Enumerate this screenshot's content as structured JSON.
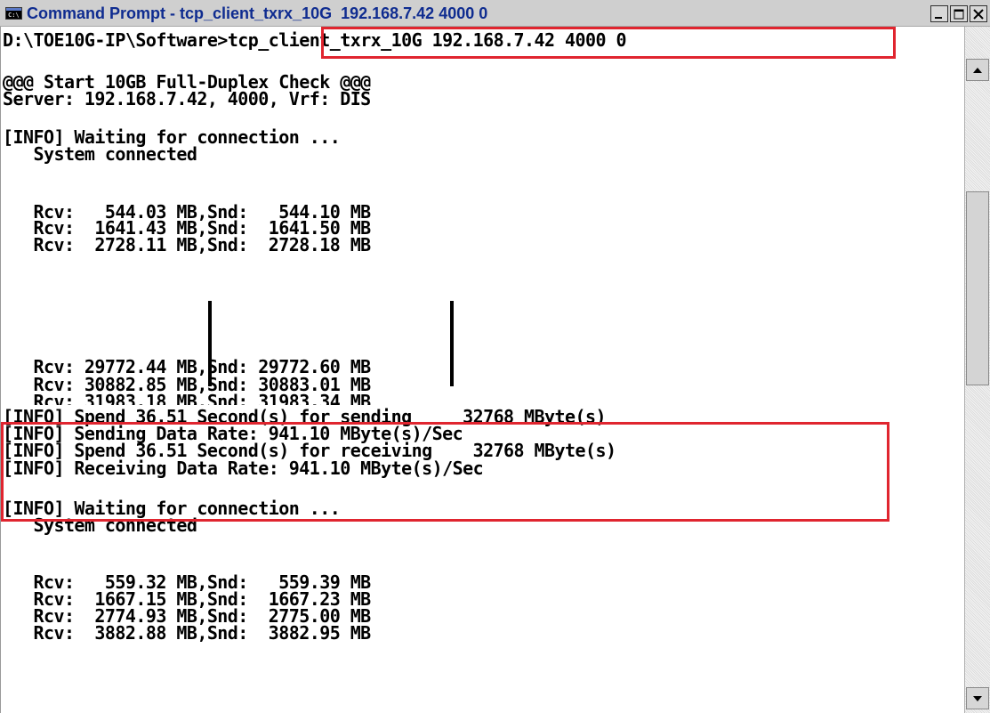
{
  "window": {
    "title": "Command Prompt - tcp_client_txrx_10G  192.168.7.42 4000 0",
    "icon": "cmd-icon",
    "icon_text": "C:\\"
  },
  "console": {
    "prompt": "D:\\TOE10G-IP\\Software>",
    "command": "tcp_client_txrx_10G 192.168.7.42 4000 0",
    "lines": [
      "@@@ Start 10GB Full-Duplex Check @@@",
      "Server: 192.168.7.42, 4000, Vrf: DIS",
      "[INFO] Waiting for connection ...",
      "   System connected",
      "   Rcv:   544.03 MB,Snd:   544.10 MB",
      "   Rcv:  1641.43 MB,Snd:  1641.50 MB",
      "   Rcv:  2728.11 MB,Snd:  2728.18 MB",
      "   Rcv: 29772.44 MB,Snd: 29772.60 MB",
      "   Rcv: 30882.85 MB,Snd: 30883.01 MB",
      "   Rcv: 31983.18 MB,Snd: 31983.34 MB",
      "[INFO] Spend 36.51 Second(s) for sending     32768 MByte(s)",
      "[INFO] Sending Data Rate: 941.10 MByte(s)/Sec",
      "[INFO] Spend 36.51 Second(s) for receiving    32768 MByte(s)",
      "[INFO] Receiving Data Rate: 941.10 MByte(s)/Sec",
      "[INFO] Waiting for connection ...",
      "   System connected",
      "   Rcv:   559.32 MB,Snd:   559.39 MB",
      "   Rcv:  1667.15 MB,Snd:  1667.23 MB",
      "   Rcv:  2774.93 MB,Snd:  2775.00 MB",
      "   Rcv:  3882.88 MB,Snd:  3882.95 MB"
    ]
  },
  "colors": {
    "title_text": "#0f2c90",
    "highlight": "#e0252f",
    "console_bg": "#ffffff",
    "console_text": "#000000"
  }
}
